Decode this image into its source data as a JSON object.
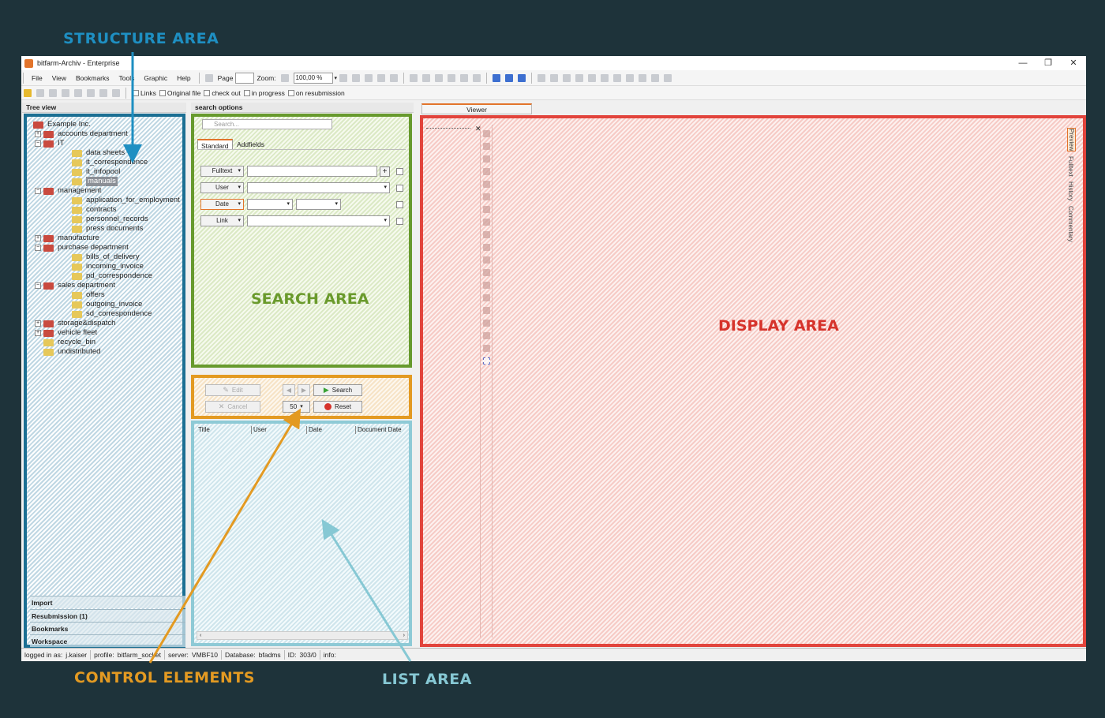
{
  "annotations": {
    "structure": "STRUCTURE AREA",
    "search": "SEARCH AREA",
    "display": "DISPLAY AREA",
    "control": "CONTROL ELEMENTS",
    "list": "LIST AREA"
  },
  "window": {
    "title": "bitfarm-Archiv - Enterprise",
    "controls": [
      "—",
      "❐",
      "✕"
    ]
  },
  "menu": [
    "File",
    "View",
    "Bookmarks",
    "Tools",
    "Graphic",
    "Help"
  ],
  "toolbar": {
    "page_label": "Page",
    "zoom_label": "Zoom:",
    "zoom_value": "100,00 %"
  },
  "filters": [
    "Links",
    "Original file",
    "check out",
    "in progress",
    "on resubmission"
  ],
  "panels": {
    "tree_title": "Tree view",
    "search_title": "search options",
    "viewer_tab": "Viewer"
  },
  "tree": [
    {
      "label": "Example Inc.",
      "level": 0,
      "icon": "house",
      "expander": ""
    },
    {
      "label": "accounts department",
      "level": 1,
      "icon": "house",
      "expander": "+"
    },
    {
      "label": "IT",
      "level": 1,
      "icon": "house",
      "expander": "-"
    },
    {
      "label": "data sheets",
      "level": 2,
      "icon": "folder",
      "expander": ""
    },
    {
      "label": "it_correspondence",
      "level": 2,
      "icon": "folder",
      "expander": ""
    },
    {
      "label": "it_infopool",
      "level": 2,
      "icon": "folder",
      "expander": ""
    },
    {
      "label": "manuals",
      "level": 2,
      "icon": "folder",
      "expander": "",
      "selected": true
    },
    {
      "label": "management",
      "level": 1,
      "icon": "house",
      "expander": "-"
    },
    {
      "label": "application_for_employment",
      "level": 2,
      "icon": "folder",
      "expander": ""
    },
    {
      "label": "contracts",
      "level": 2,
      "icon": "folder",
      "expander": ""
    },
    {
      "label": "personnel_records",
      "level": 2,
      "icon": "folder",
      "expander": ""
    },
    {
      "label": "press documents",
      "level": 2,
      "icon": "folder",
      "expander": ""
    },
    {
      "label": "manufacture",
      "level": 1,
      "icon": "house",
      "expander": "+"
    },
    {
      "label": "purchase department",
      "level": 1,
      "icon": "house",
      "expander": "-"
    },
    {
      "label": "bills_of_delivery",
      "level": 2,
      "icon": "folder",
      "expander": ""
    },
    {
      "label": "incoming_invoice",
      "level": 2,
      "icon": "folder",
      "expander": ""
    },
    {
      "label": "pd_correspondence",
      "level": 2,
      "icon": "folder",
      "expander": ""
    },
    {
      "label": "sales department",
      "level": 1,
      "icon": "house",
      "expander": "-"
    },
    {
      "label": "offers",
      "level": 2,
      "icon": "folder",
      "expander": ""
    },
    {
      "label": "outgoing_invoice",
      "level": 2,
      "icon": "folder",
      "expander": ""
    },
    {
      "label": "sd_correspondence",
      "level": 2,
      "icon": "folder",
      "expander": ""
    },
    {
      "label": "storage&dispatch",
      "level": 1,
      "icon": "house",
      "expander": "+"
    },
    {
      "label": "vehicle fleet",
      "level": 1,
      "icon": "house",
      "expander": "+"
    },
    {
      "label": "recycle_bin",
      "level": 1,
      "icon": "folder",
      "expander": ""
    },
    {
      "label": "undistributed",
      "level": 1,
      "icon": "folder",
      "expander": ""
    }
  ],
  "accordion": [
    "Import",
    "Resubmission (1)",
    "Bookmarks",
    "Workspace"
  ],
  "search": {
    "placeholder": "Search...",
    "tabs": [
      "Standard",
      "Addfields"
    ],
    "fields": [
      "Fulltext",
      "User",
      "Date",
      "Link"
    ]
  },
  "controls": {
    "edit": "Edit",
    "cancel": "Cancel",
    "search": "Search",
    "reset": "Reset",
    "page_size": "50"
  },
  "list": {
    "columns": [
      "Title",
      "User",
      "Date",
      "Document Date"
    ]
  },
  "viewer": {
    "side_tabs": [
      "Preview",
      "Fulltext",
      "History",
      "Commentary"
    ]
  },
  "status": [
    {
      "label": "logged in as:",
      "value": "j.kaiser"
    },
    {
      "label": "profile:",
      "value": "bitfarm_socket"
    },
    {
      "label": "server:",
      "value": "VMBF10"
    },
    {
      "label": "Database:",
      "value": "bfadms"
    },
    {
      "label": "ID:",
      "value": "303/0"
    },
    {
      "label": "info:",
      "value": ""
    }
  ],
  "colors": {
    "structure": "#1b6f93",
    "search": "#679a2d",
    "control": "#e39a22",
    "list": "#8ecad6",
    "display": "#e2443c",
    "background": "#1e333a"
  }
}
